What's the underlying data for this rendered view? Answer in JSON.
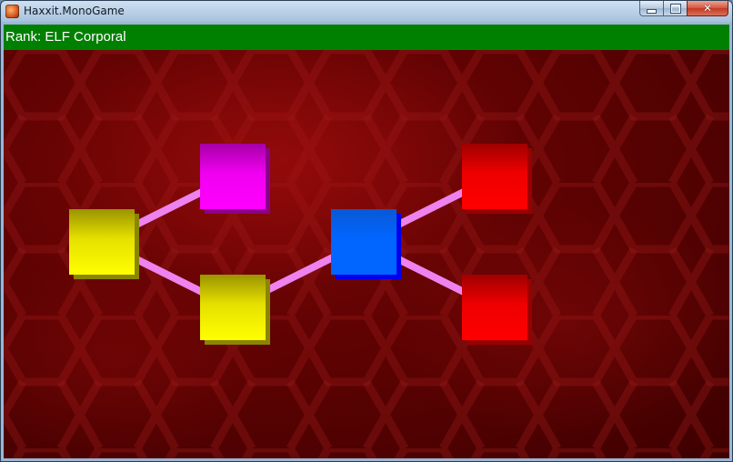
{
  "window": {
    "title": "Haxxit.MonoGame",
    "icon": "app-icon"
  },
  "controls": {
    "minimize_icon": "minimize-icon",
    "maximize_icon": "maximize-icon",
    "close_icon": "close-icon",
    "close_glyph": "✕"
  },
  "rank": {
    "text": "Rank: ELF Corporal",
    "bar_color": "#008000"
  },
  "colors": {
    "link": "#ee82ee",
    "background": "#5e0202",
    "yellow": "#ffff00",
    "magenta": "#ff00ff",
    "blue": "#0066ff",
    "red": "#ff0000"
  },
  "map": {
    "nodes": [
      {
        "id": "node-left-yellow",
        "color": "yellow"
      },
      {
        "id": "node-top-magenta",
        "color": "magenta"
      },
      {
        "id": "node-bottom-yellow",
        "color": "yellow"
      },
      {
        "id": "node-center-blue",
        "color": "blue"
      },
      {
        "id": "node-top-right-red",
        "color": "red"
      },
      {
        "id": "node-bottom-right-red",
        "color": "red"
      }
    ],
    "links": [
      [
        "node-left-yellow",
        "node-top-magenta"
      ],
      [
        "node-left-yellow",
        "node-bottom-yellow"
      ],
      [
        "node-bottom-yellow",
        "node-center-blue"
      ],
      [
        "node-center-blue",
        "node-top-right-red"
      ],
      [
        "node-center-blue",
        "node-bottom-right-red"
      ]
    ]
  }
}
